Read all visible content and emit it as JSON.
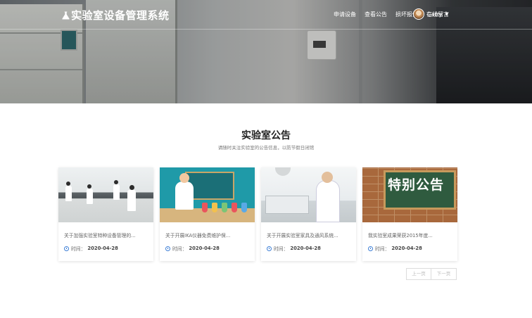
{
  "header": {
    "brand": "实验室设备管理系统",
    "nav": [
      "申请设备",
      "查看公告",
      "损坏报修",
      "在线留言"
    ],
    "user": "Carry"
  },
  "section": {
    "title": "实验室公告",
    "subtitle": "请随时关注实验室的公告信息，以防节假日闭馆"
  },
  "cards": [
    {
      "title": "关于加强实验室特种设备管理的...",
      "time_label": "时间：",
      "date": "2020-04-28",
      "image": "lab-students-photo"
    },
    {
      "title": "关于开展IKA仪器免费维护保...",
      "time_label": "时间：",
      "date": "2020-04-28",
      "image": "scientist-illustration"
    },
    {
      "title": "关于开展实验室家具及通风系统...",
      "time_label": "时间：",
      "date": "2020-04-28",
      "image": "researcher-instrument-photo"
    },
    {
      "title": "我实验室成果荣获2015年度...",
      "time_label": "时间：",
      "date": "2020-04-28",
      "image": "special-notice-board",
      "image_text": "特别公告"
    }
  ],
  "pagination": {
    "prev": "上一页",
    "next": "下一页"
  }
}
